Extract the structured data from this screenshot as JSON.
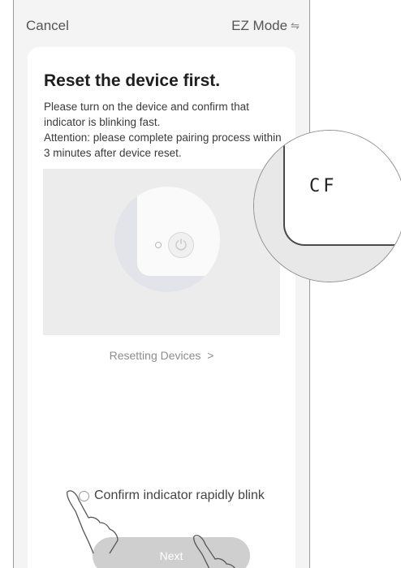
{
  "header": {
    "cancel_label": "Cancel",
    "mode_label": "EZ Mode",
    "mode_icon": "swap-arrows-icon"
  },
  "card": {
    "title": "Reset the device first.",
    "desc_line1": "Please turn on the device and confirm that indicator is blinking fast.",
    "desc_line2": "Attention: please complete pairing process within 3 minutes after device reset.",
    "link_label": "Resetting Devices"
  },
  "zoom": {
    "display_code": "CF"
  },
  "confirm": {
    "label": "Confirm indicator rapidly blink",
    "checked": false
  },
  "next_button": {
    "label": "Next",
    "enabled": false
  },
  "colors": {
    "accent_disabled": "#cfcfcf",
    "background": "#f4f4f4"
  }
}
